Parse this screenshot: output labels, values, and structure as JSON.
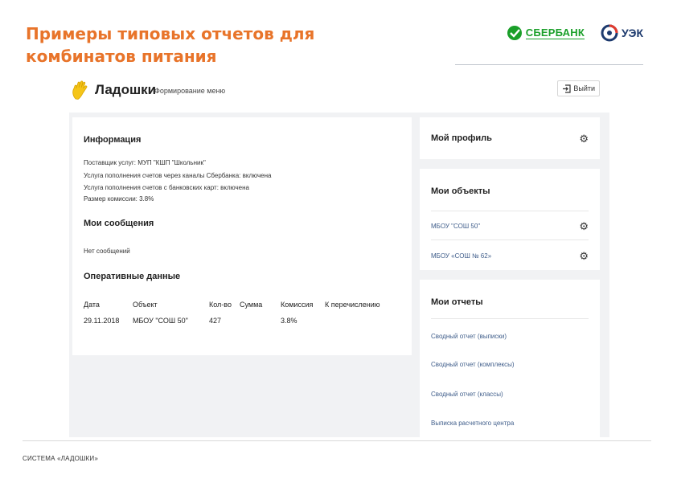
{
  "slide": {
    "title_line1": "Примеры типовых отчетов для",
    "title_line2": "комбинатов питания",
    "footer": "СИСТЕМА «ЛАДОШКИ»"
  },
  "logos": {
    "sberbank": "СБЕРБАНК",
    "uek": "УЭК"
  },
  "header": {
    "brand": "Ладошки",
    "menu": "Формирование меню",
    "logout": "Выйти"
  },
  "info": {
    "title": "Информация",
    "lines": [
      "Поставщик услуг: МУП \"КШП \"Школьник\"",
      "Услуга пополнения счетов через каналы Сбербанка: включена",
      "Услуга пополнения счетов с банковских карт: включена",
      "Размер комиссии: 3.8%"
    ]
  },
  "messages": {
    "title": "Мои сообщения",
    "empty": "Нет сообщений"
  },
  "operational": {
    "title": "Оперативные данные",
    "columns": [
      "Дата",
      "Объект",
      "Кол-во",
      "Сумма",
      "Комиссия",
      "К перечислению"
    ],
    "rows": [
      [
        "29.11.2018",
        "МБОУ \"СОШ 50\"",
        "427",
        "",
        "3.8%",
        ""
      ]
    ]
  },
  "profile": {
    "title": "Мой профиль"
  },
  "objects": {
    "title": "Мои объекты",
    "items": [
      "МБОУ \"СОШ 50\"",
      "МБОУ «СОШ № 62»"
    ]
  },
  "reports": {
    "title": "Мои отчеты",
    "items": [
      "Сводный отчет (выписки)",
      "Сводный отчет (комплексы)",
      "Сводный отчет (классы)",
      "Выписка расчетного центра"
    ]
  },
  "colors": {
    "title_orange": "#e8742a",
    "sber_green": "#1a9f29",
    "uek_blue": "#1d3a6e",
    "link_blue": "#3f5d8a",
    "panel_bg": "#f1f2f4",
    "palm_yellow": "#f5c518"
  },
  "icons": {
    "brand": "palm-hand-icon",
    "logout": "logout-icon",
    "settings": "gear-icon"
  }
}
